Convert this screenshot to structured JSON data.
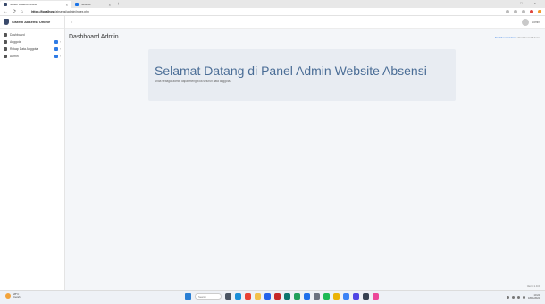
{
  "browser": {
    "tabs": [
      {
        "label": "Sistem Absensi Online",
        "active": true
      },
      {
        "label": "Sintesis",
        "active": false
      }
    ],
    "new_tab": "+",
    "window_controls": "– □ ×",
    "url_host": "https://localhost",
    "url_path": "/absensi/admin/index.php"
  },
  "app": {
    "brand": "Sistem Absensi Online",
    "menu": [
      {
        "label": "Dashboard",
        "icon": "dashboard-icon",
        "badge": false
      },
      {
        "label": "Anggota",
        "icon": "users-icon",
        "badge": true
      },
      {
        "label": "Rekap Data Anggota",
        "icon": "calendar-icon",
        "badge": true
      },
      {
        "label": "Admin",
        "icon": "gear-icon",
        "badge": true
      }
    ],
    "user": "Admin"
  },
  "page": {
    "title": "Dashboard Admin",
    "breadcrumb_link": "Dashboard Admin",
    "breadcrumb_current": "Dashboard Admin",
    "hero_title": "Selamat Datang di Panel Admin Website Absensi",
    "hero_sub": "Anda sebagai admin dapat mengelola seluruh data anggota.",
    "version": "Versi 1.0.0"
  },
  "taskbar": {
    "weather_temp": "28°C",
    "weather_desc": "Cerah",
    "search_placeholder": "Search",
    "time": "10:24",
    "date": "18/01/2024"
  },
  "colors": {
    "accent": "#2f7be5",
    "hero_text": "#4a6d96",
    "hero_bg": "#e8ecf2"
  }
}
